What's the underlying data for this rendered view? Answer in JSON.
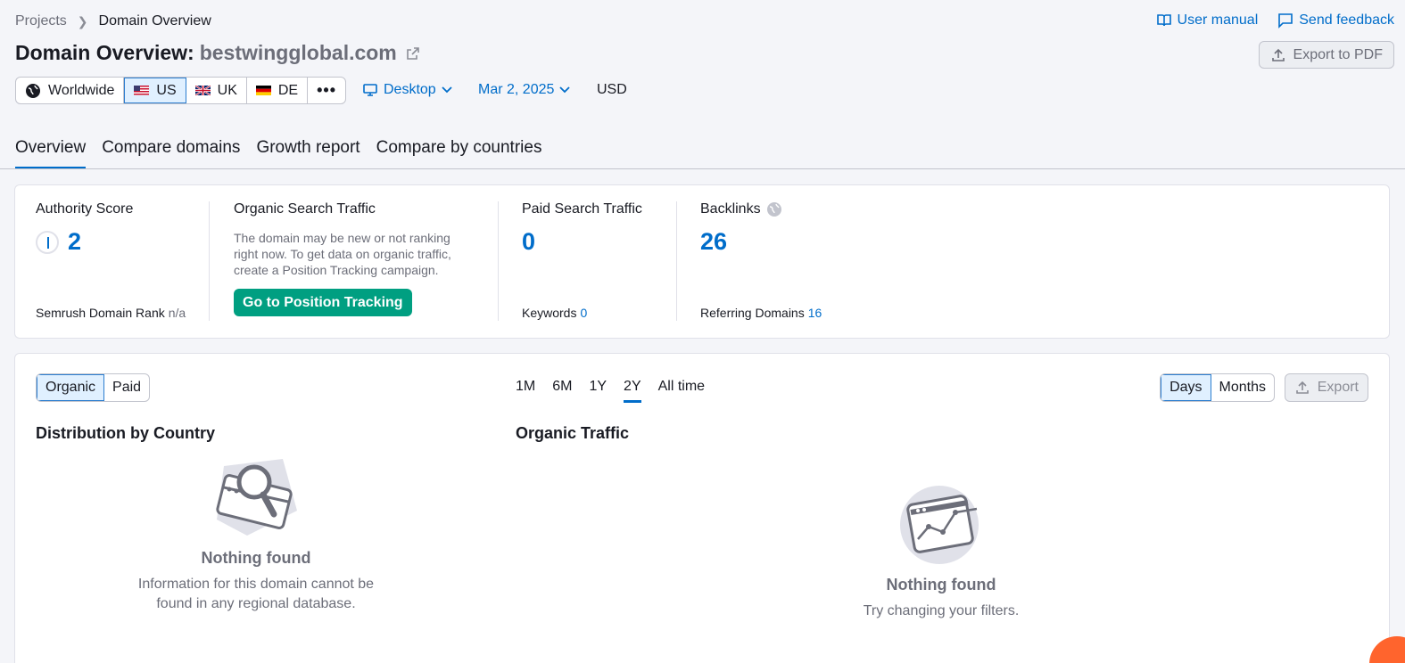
{
  "breadcrumb": {
    "projects": "Projects",
    "current": "Domain Overview"
  },
  "top_links": {
    "user_manual": "User manual",
    "send_feedback": "Send feedback"
  },
  "title": {
    "prefix": "Domain Overview:",
    "domain": "bestwingglobal.com"
  },
  "export_pdf": "Export to PDF",
  "databases": [
    {
      "label": "Worldwide",
      "icon": "globe-icon",
      "active": false
    },
    {
      "label": "US",
      "icon": "us-flag",
      "active": true
    },
    {
      "label": "UK",
      "icon": "uk-flag",
      "active": false
    },
    {
      "label": "DE",
      "icon": "de-flag",
      "active": false
    }
  ],
  "device": "Desktop",
  "date": "Mar 2, 2025",
  "currency": "USD",
  "tabs": [
    "Overview",
    "Compare domains",
    "Growth report",
    "Compare by countries"
  ],
  "metrics": {
    "authority": {
      "title": "Authority Score",
      "value": "2",
      "foot_label": "Semrush Domain Rank",
      "foot_value": "n/a"
    },
    "organic": {
      "title": "Organic Search Traffic",
      "desc": "The domain may be new or not ranking right now. To get data on organic traffic, create a Position Tracking campaign.",
      "button": "Go to Position Tracking"
    },
    "paid": {
      "title": "Paid Search Traffic",
      "value": "0",
      "foot_label": "Keywords",
      "foot_value": "0"
    },
    "backlinks": {
      "title": "Backlinks",
      "value": "26",
      "foot_label": "Referring Domains",
      "foot_value": "16"
    }
  },
  "traffic_toggle": [
    "Organic",
    "Paid"
  ],
  "periods": [
    "1M",
    "6M",
    "1Y",
    "2Y",
    "All time"
  ],
  "granularity": [
    "Days",
    "Months"
  ],
  "export": "Export",
  "distribution": {
    "title": "Distribution by Country",
    "empty_title": "Nothing found",
    "empty_text": "Information for this domain cannot be found in any regional database."
  },
  "organic_traffic": {
    "title": "Organic Traffic",
    "empty_title": "Nothing found",
    "empty_text": "Try changing your filters."
  },
  "colors": {
    "accent": "#006dca",
    "green": "#009f81",
    "orange": "#ff642d"
  }
}
